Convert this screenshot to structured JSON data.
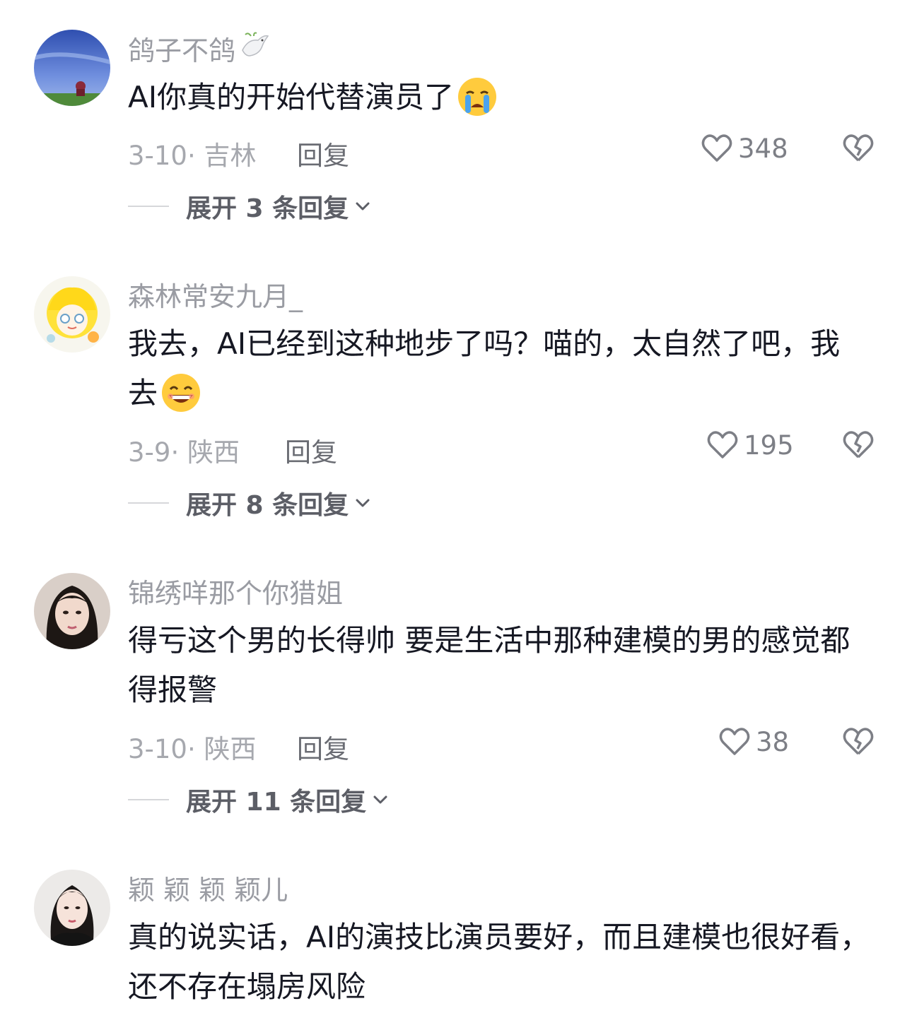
{
  "comments": [
    {
      "username": "鸽子不鸽",
      "username_emoji": "dove-emoji",
      "text": "AI你真的开始代替演员了",
      "text_emoji": "crying-face-emoji",
      "date": "3-10",
      "location": "吉林",
      "reply_label": "回复",
      "likes": "348",
      "expand_label": "展开 3 条回复",
      "avatar": "sky-landscape-avatar"
    },
    {
      "username": "森林常安九月_",
      "text": "我去，AI已经到这种地步了吗？喵的，太自然了吧，我去",
      "text_emoji": "grinning-face-emoji",
      "date": "3-9",
      "location": "陕西",
      "reply_label": "回复",
      "likes": "195",
      "expand_label": "展开 8 条回复",
      "avatar": "cartoon-girl-avatar"
    },
    {
      "username": "锦绣咩那个你猎姐",
      "text": "得亏这个男的长得帅  要是生活中那种建模的男的感觉都得报警",
      "date": "3-10",
      "location": "陕西",
      "reply_label": "回复",
      "likes": "38",
      "expand_label": "展开 11 条回复",
      "avatar": "woman-portrait-avatar"
    },
    {
      "username": "颖 颖 颖  颖儿",
      "text": "真的说实话，AI的演技比演员要好，而且建模也很好看，还不存在塌房风险",
      "avatar": "woman-portrait-avatar-2"
    }
  ],
  "colors": {
    "username": "#9a9ca3",
    "text": "#161823",
    "meta": "#a6a8ae",
    "reply": "#6a6c73",
    "expand": "#5c5e66",
    "icon": "#7d7f86"
  }
}
